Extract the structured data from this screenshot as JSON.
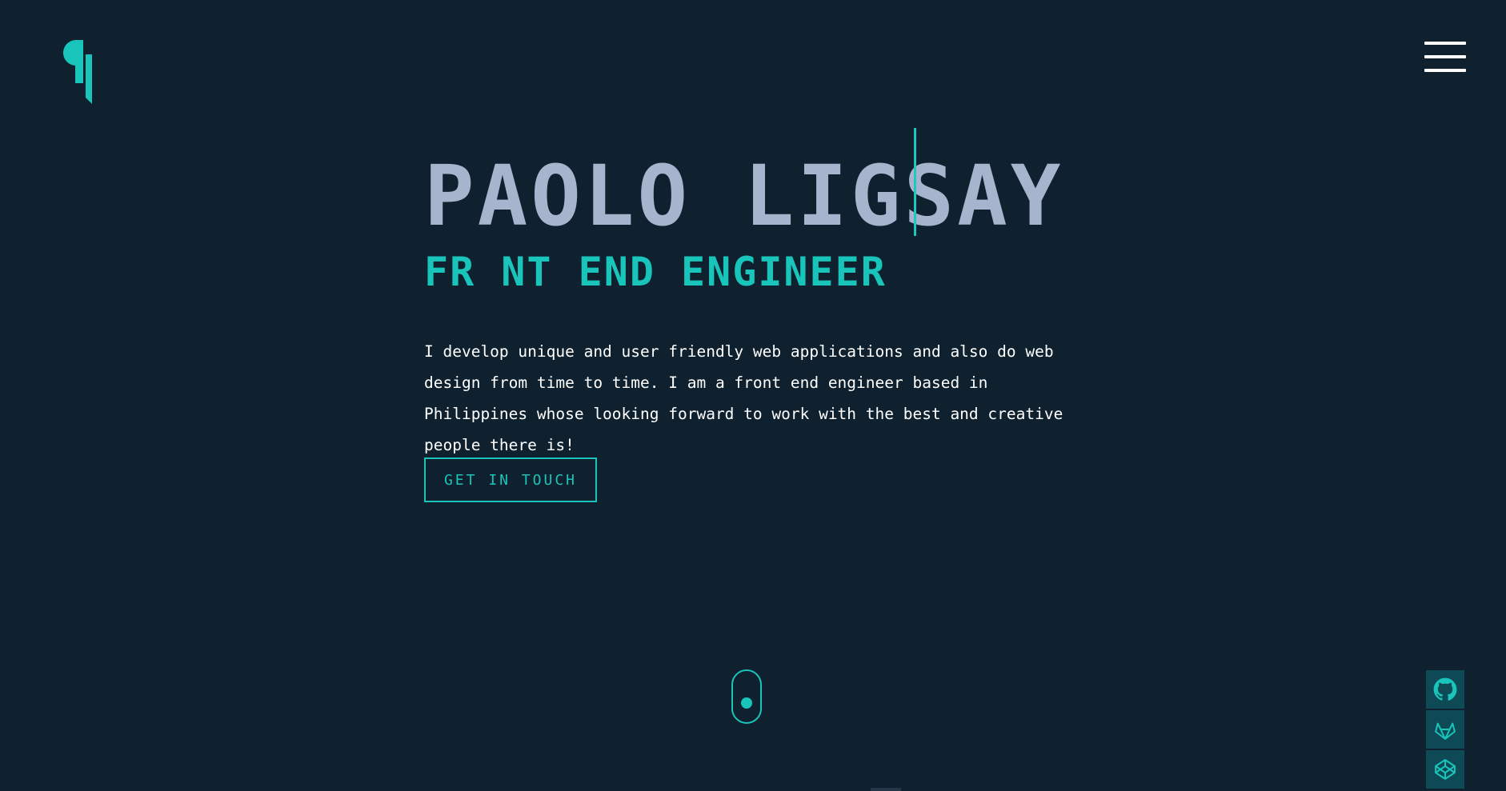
{
  "colors": {
    "background": "#0f212e",
    "accent": "#19c4bb",
    "name": "#a6b4cd",
    "text": "#ffffff",
    "social_bg": "#0e4a55"
  },
  "header": {
    "logo_icon": "pilcrow-logo-icon",
    "menu_icon": "hamburger-menu-icon"
  },
  "hero": {
    "name": "PAOLO LIGSAY",
    "subtitle": "FR NT END ENGINEER",
    "description": "I develop unique and user friendly web applications and also do web design from time to time. I am a front end engineer based in Philippines whose looking forward to work with the best and creative people there is!",
    "cta_label": "GET IN TOUCH"
  },
  "scroll_indicator": {
    "icon": "scroll-mouse-icon"
  },
  "socials": [
    {
      "icon": "github-icon"
    },
    {
      "icon": "gitlab-icon"
    },
    {
      "icon": "codepen-icon"
    }
  ]
}
